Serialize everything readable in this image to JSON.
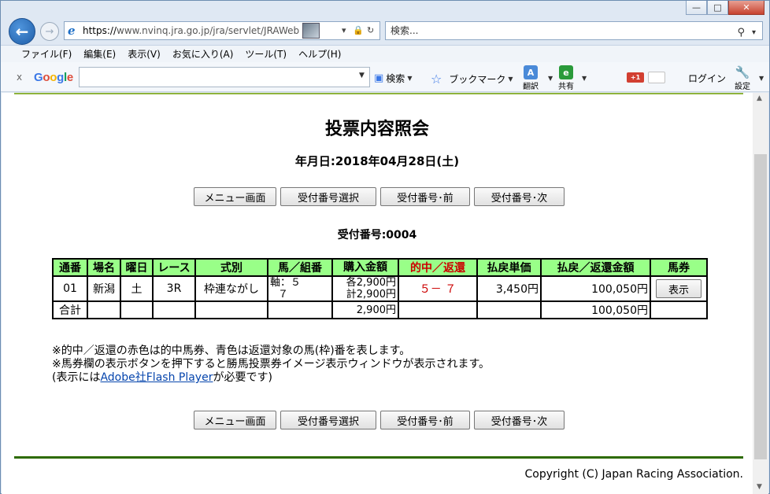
{
  "browser": {
    "url_scheme": "https://",
    "url_rest": "www.nvinq.jra.go.jp/jra/servlet/JRAWeb",
    "search_placeholder": "検索...",
    "menu": [
      "ファイル(F)",
      "編集(E)",
      "表示(V)",
      "お気に入り(A)",
      "ツール(T)",
      "ヘルプ(H)"
    ],
    "toolbar": {
      "search_label": "検索",
      "bookmark_label": "ブックマーク",
      "translate_label": "翻訳",
      "share_label": "共有",
      "login_label": "ログイン",
      "settings_label": "設定",
      "gplus_label": "+1"
    }
  },
  "page": {
    "title": "投票内容照会",
    "date_line": "年月日:2018年04月28日(土)",
    "buttons": {
      "menu": "メニュー画面",
      "select": "受付番号選択",
      "prev": "受付番号･前",
      "next": "受付番号･次"
    },
    "receipt_line": "受付番号:0004",
    "table": {
      "headers": [
        "通番",
        "場名",
        "曜日",
        "レース",
        "式別",
        "馬／組番",
        "購入金額",
        "的中／返還",
        "払戻単価",
        "払戻／返還金額",
        "馬券"
      ],
      "row": {
        "num": "01",
        "venue": "新潟",
        "day": "土",
        "race": "3R",
        "type": "枠連ながし",
        "horse_line1": "軸：５",
        "horse_line2": "７",
        "amount_line1": "各2,900円",
        "amount_line2": "計2,900円",
        "hit": "５－ ７",
        "unit": "3,450円",
        "payout": "100,050円",
        "ticket_button": "表示"
      },
      "total": {
        "label": "合計",
        "amount": "2,900円",
        "payout": "100,050円"
      }
    },
    "notes": {
      "line1": "※的中／返還の赤色は的中馬券、青色は返還対象の馬(枠)番を表します。",
      "line2": "※馬券欄の表示ボタンを押下すると勝馬投票券イメージ表示ウィンドウが表示されます。",
      "line3_pre": "(表示には",
      "line3_link": "Adobe社Flash Player",
      "line3_post": "が必要です)"
    },
    "copyright": "Copyright (C) Japan Racing Association."
  }
}
